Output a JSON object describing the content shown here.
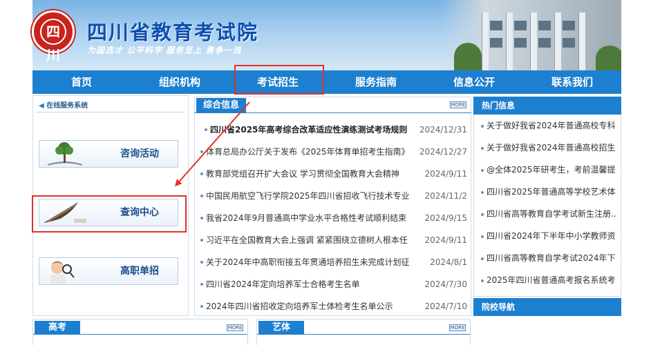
{
  "header": {
    "logo_text": "四川",
    "title": "四川省教育考试院",
    "slogan": "为国选才  公平科学  服务至上  勇争一流"
  },
  "nav": {
    "items": [
      "首页",
      "组织机构",
      "考试招生",
      "服务指南",
      "信息公开",
      "联系我们"
    ]
  },
  "left_panel": {
    "title": "在线服务系统",
    "services": [
      "咨询活动",
      "查询中心",
      "高职单招"
    ]
  },
  "news": {
    "tab": "综合信息",
    "more_label": "MORE",
    "items": [
      {
        "title": "四川省2025年高考综合改革适应性演练测试考场规则",
        "date": "2024/12/31"
      },
      {
        "title": "体育总局办公厅关于发布《2025年体育单招考生指南》",
        "date": "2024/12/27"
      },
      {
        "title": "教育部党组召开扩大会议 学习贯彻全国教育大会精神",
        "date": "2024/9/11"
      },
      {
        "title": "中国民用航空飞行学院2025年四川省招收飞行技术专业",
        "date": "2024/11/2"
      },
      {
        "title": "我省2024年9月普通高中学业水平合格性考试顺利结束",
        "date": "2024/9/15"
      },
      {
        "title": "习近平在全国教育大会上强调 紧紧围绕立德树人根本任",
        "date": "2024/9/11"
      },
      {
        "title": "关于2024年中高职衔接五年贯通培养招生未完成计划征",
        "date": "2024/8/1"
      },
      {
        "title": "四川省2024年定向培养军士合格考生名单",
        "date": "2024/7/30"
      },
      {
        "title": "2024年四川省招收定向培养军士体检考生名单公示",
        "date": "2024/7/10"
      }
    ]
  },
  "hot": {
    "title": "热门信息",
    "items": [
      "关于做好我省2024年普通高校专科...",
      "关于做好我省2024年普通高校招生...",
      "@全体2025年研考生，考前温馨提...",
      "四川省2025年普通高等学校艺术体...",
      "四川省高等教育自学考试新生注册...",
      "四川省2024年下半年中小学教师资...",
      "四川省高等教育自学考试2024年下...",
      "2025年四川省普通高考报名系统考..."
    ]
  },
  "school_nav": {
    "title": "院校导航"
  },
  "bottom": {
    "tab1": "高考",
    "tab2": "艺体",
    "more_label": "MORE"
  },
  "colors": {
    "nav_blue": "#1d7fcf",
    "title_blue": "#0d4fb0",
    "highlight_red": "#e0302a",
    "logo_red": "#c8231d"
  }
}
